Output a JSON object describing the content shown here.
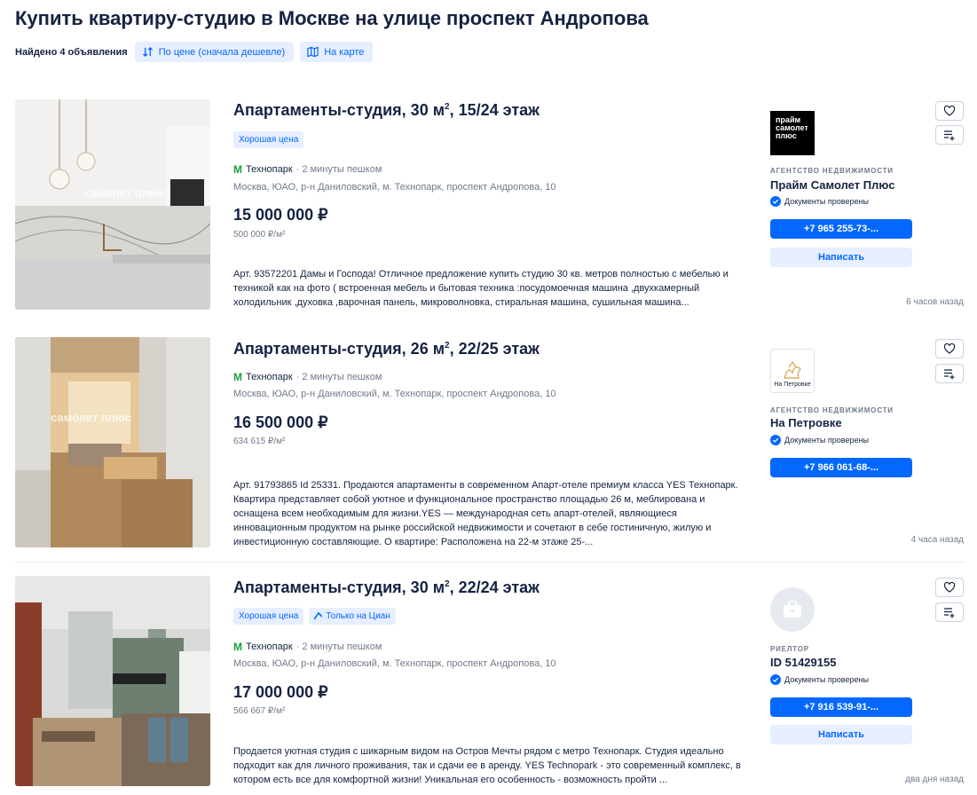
{
  "page": {
    "title": "Купить квартиру-студию в Москве на улице проспект Андропова",
    "found": "Найдено 4 объявления",
    "sort_label": "По цене (сначала дешевле)",
    "map_label": "На карте"
  },
  "colors": {
    "accent": "#0468ff",
    "accent_light": "#e6eeff",
    "text": "#152242",
    "muted": "#707a89",
    "metro_green": "#1a9e3d"
  },
  "listings": [
    {
      "title_main": "Апартаменты-студия, 30 м",
      "title_sup": "2",
      "title_tail": ", 15/24 этаж",
      "tags": [
        "Хорошая цена"
      ],
      "metro": "Технопарк",
      "walk": "· 2 минуты пешком",
      "address": "Москва, ЮАО, р-н Даниловский, м. Технопарк, проспект Андропова, 10",
      "price": "15 000 000 ₽",
      "price_per_m": "500 000 ₽/м²",
      "description": "Арт. 93572201 Дамы и Господа! Отличное предложение купить студию 30 кв. метров полностью с мебелью и техникой как на фото ( встроенная мебель и бытовая техника :посудомоечная машина ,двухкамерный холодильник ,духовка ,варочная панель, микроволновка, стиральная машина, сушильная машина...",
      "agent_type": "АГЕНТСТВО НЕДВИЖИМОСТИ",
      "agent_name": "Прайм Самолет Плюс",
      "logo_text": "прайм самолет плюс",
      "verified": "Документы проверены",
      "phone": "+7 965 255-73-...",
      "message": "Написать",
      "time": "6 часов назад",
      "watermark": "самолет плюс"
    },
    {
      "title_main": "Апартаменты-студия, 26 м",
      "title_sup": "2",
      "title_tail": ", 22/25 этаж",
      "tags": [],
      "metro": "Технопарк",
      "walk": "· 2 минуты пешком",
      "address": "Москва, ЮАО, р-н Даниловский, м. Технопарк, проспект Андропова, 10",
      "price": "16 500 000 ₽",
      "price_per_m": "634 615 ₽/м²",
      "description": "Арт. 91793865 Id 25331. Продаются апартаменты в современном Апарт-отеле премиум класса YES Технопарк. Квартира представляет собой уютное и функциональное пространство площадью 26 м, меблирована и оснащена всем необходимым для жизни.YES — международная сеть апарт-отелей, являющиеся инновационным продуктом на рынке российской недвижимости и сочетают в себе гостиничную, жилую и инвестиционную составляющие. О квартире: Расположена на 22-м этаже 25-...",
      "agent_type": "АГЕНТСТВО НЕДВИЖИМОСТИ",
      "agent_name": "На Петровке",
      "logo_text": "На Петровке",
      "verified": "Документы проверены",
      "phone": "+7 966 061-68-...",
      "time": "4 часа назад",
      "watermark": "самолет плюс"
    },
    {
      "title_main": "Апартаменты-студия, 30 м",
      "title_sup": "2",
      "title_tail": ", 22/24 этаж",
      "tags": [
        "Хорошая цена",
        "Только на Циан"
      ],
      "metro": "Технопарк",
      "walk": "· 2 минуты пешком",
      "address": "Москва, ЮАО, р-н Даниловский, м. Технопарк, проспект Андропова, 10",
      "price": "17 000 000 ₽",
      "price_per_m": "566 667 ₽/м²",
      "description": "Продается уютная студия с шикарным видом на Остров Мечты рядом с метро Технопарк. Студия идеально подходит как для личного проживания, так и сдачи ее в аренду. YES Technopark - это современный комплекс, в котором есть все для комфортной жизни! Уникальная его особенность - возможность пройти ...",
      "agent_type": "РИЕЛТОР",
      "agent_name": "ID 51429155",
      "verified": "Документы проверены",
      "phone": "+7 916 539-91-...",
      "message": "Написать",
      "time": "два дня назад"
    }
  ]
}
